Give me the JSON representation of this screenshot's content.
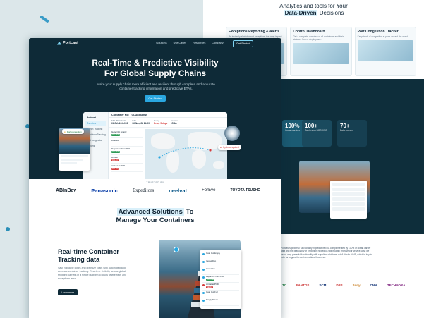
{
  "back_page": {
    "heading_line1": "Analytics and tools for Your",
    "heading_highlight": "Data-Driven",
    "heading_rest": "Decisions",
    "cards": [
      {
        "title": "Exceptions Reporting & Alerts",
        "desc": "Be instantly alerted about exceptions that may impact your shipments."
      },
      {
        "title": "Control Dashboard",
        "desc": "Get a complete overview of all containers and their statuses from a single place."
      },
      {
        "title": "Port Congestion Tracker",
        "desc": "Keep track of congestion at ports around the world."
      }
    ],
    "stats": [
      {
        "value": "100%",
        "label": "Ocean carriers"
      },
      {
        "value": "100+",
        "label": "Carriers on BOOKING"
      },
      {
        "value": "70+",
        "label": "Data sources"
      }
    ],
    "quote": "Portcast's powerful functionality in predictive ETA complemented by 100% of ocean carrier data and the granularity of prediction helped us significantly improve our service. Also we heard very powerful functionality with suppliers which we didn't fit with AIMS, which is key to help us to grow its our international business.",
    "logos": [
      "TC",
      "PANTOS",
      "SCM",
      "",
      "DPS",
      "Sony",
      "CMA",
      "TECHNORA"
    ]
  },
  "nav": {
    "logo": "Portcast",
    "links": [
      "Solutions",
      "Use Cases",
      "Resources",
      "Company"
    ],
    "cta": "Get Started"
  },
  "hero": {
    "title_line1": "Real-Time & Predictive Visibility",
    "title_line2": "For Global Supply Chains",
    "subtitle": "Make your supply chain more efficient and resilient through complete and accurate container tracking information and predictive ETAs.",
    "cta": "Get Started"
  },
  "app": {
    "sidebar": [
      "Portcast",
      "Overview",
      "Ocean Tracking",
      "Container Tracking",
      "Port congestion",
      "Reports"
    ],
    "header": "Container No: TCLU8548949",
    "meta": [
      {
        "label": "MBL/BOOKING",
        "value": "HLCU-BOK-009"
      },
      {
        "label": "ETA",
        "value": "06 Nov, 22 14:00"
      },
      {
        "label": "Delay",
        "value": "Delay 5 days"
      },
      {
        "label": "Carrier",
        "value": "CMA"
      }
    ],
    "list": [
      {
        "title": "Gate Out Empty",
        "tag": "ON TIME",
        "tag_color": "#2e9a55"
      },
      {
        "title": "Loaded",
        "tag": "",
        "tag_color": ""
      },
      {
        "title": "Departure from POL",
        "tag": "ON TIME",
        "tag_color": "#2e9a55"
      },
      {
        "title": "Arrival",
        "tag": "DELAY",
        "tag_color": "#d43c3c"
      },
      {
        "title": "Arrival at POD",
        "tag": "DELAY",
        "tag_color": "#d43c3c"
      },
      {
        "title": "Gate Out",
        "tag": "",
        "tag_color": ""
      }
    ]
  },
  "badges": {
    "left": "Port congestion",
    "right": "Cyclone spotted"
  },
  "trusted_label": "TRUSTED BY",
  "brands": [
    "ABInBev",
    "Panasonic",
    "Expeditors",
    "neelvat",
    "ForEye",
    "TOYOTA TSUSHO"
  ],
  "section": {
    "highlight": "Advanced Solutions",
    "title_rest": "To",
    "title_line2": "Manage Your Containers"
  },
  "realtime": {
    "title_line1": "Real-time Container",
    "title_line2": "Tracking data",
    "desc": "Save valuable hours and optimize costs with automated and accurate container tracking. Real-time visibility across global shipping carriers in a single platform to know where risks and exceptions arise.",
    "button": "Learn more"
  },
  "track_card": [
    {
      "title": "Gate Out Empty",
      "tag": "",
      "color": ""
    },
    {
      "title": "Vessel Dep",
      "tag": "",
      "color": ""
    },
    {
      "title": "Vessel Arr",
      "tag": "",
      "color": ""
    },
    {
      "title": "Departure from POL",
      "tag": "ON TIME",
      "color": "#2e9a55"
    },
    {
      "title": "Arrival at POD",
      "tag": "DELAY",
      "color": "#d43c3c"
    },
    {
      "title": "Gate Out Full",
      "tag": "",
      "color": ""
    },
    {
      "title": "Empty Return",
      "tag": "",
      "color": ""
    }
  ],
  "colors": {
    "dark": "#0e2a37",
    "accent": "#2aa7e0",
    "highlight_bg": "#d9f0fa",
    "alert": "#d43c3c"
  }
}
